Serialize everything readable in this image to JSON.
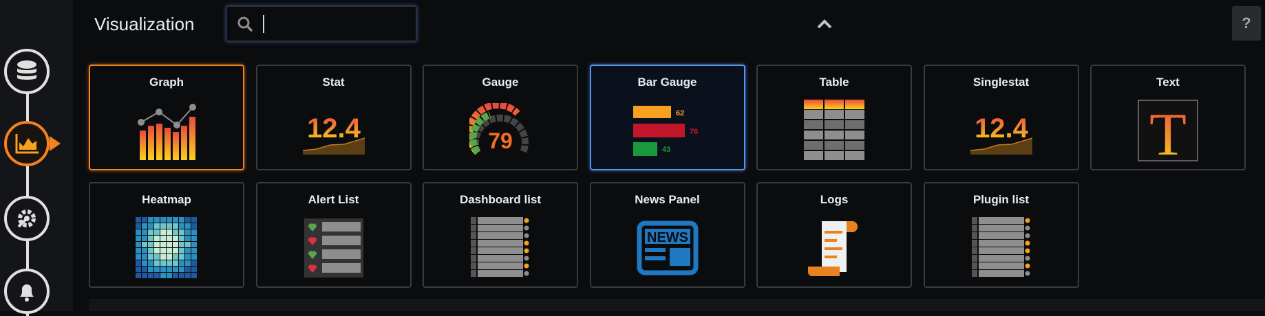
{
  "header": {
    "title": "Visualization",
    "search_value": "",
    "help_label": "?"
  },
  "sidebar": {
    "steps": [
      "queries",
      "visualization",
      "general",
      "alert"
    ]
  },
  "cards": [
    {
      "label": "Graph",
      "icon": "graph-icon"
    },
    {
      "label": "Stat",
      "icon": "stat-icon",
      "value": "12.4"
    },
    {
      "label": "Gauge",
      "icon": "gauge-icon",
      "value": "79"
    },
    {
      "label": "Bar Gauge",
      "icon": "bar-gauge-icon",
      "values": [
        "62",
        "76",
        "43"
      ]
    },
    {
      "label": "Table",
      "icon": "table-icon"
    },
    {
      "label": "Singlestat",
      "icon": "singlestat-icon",
      "value": "12.4"
    },
    {
      "label": "Text",
      "icon": "text-icon",
      "glyph": "T"
    },
    {
      "label": "Heatmap",
      "icon": "heatmap-icon"
    },
    {
      "label": "Alert List",
      "icon": "alert-list-icon"
    },
    {
      "label": "Dashboard list",
      "icon": "dashboard-list-icon"
    },
    {
      "label": "News Panel",
      "icon": "news-icon",
      "word": "NEWS"
    },
    {
      "label": "Logs",
      "icon": "logs-icon"
    },
    {
      "label": "Plugin list",
      "icon": "plugin-list-icon"
    }
  ],
  "colors": {
    "selected": "#f58220",
    "hover": "#5794f2"
  }
}
